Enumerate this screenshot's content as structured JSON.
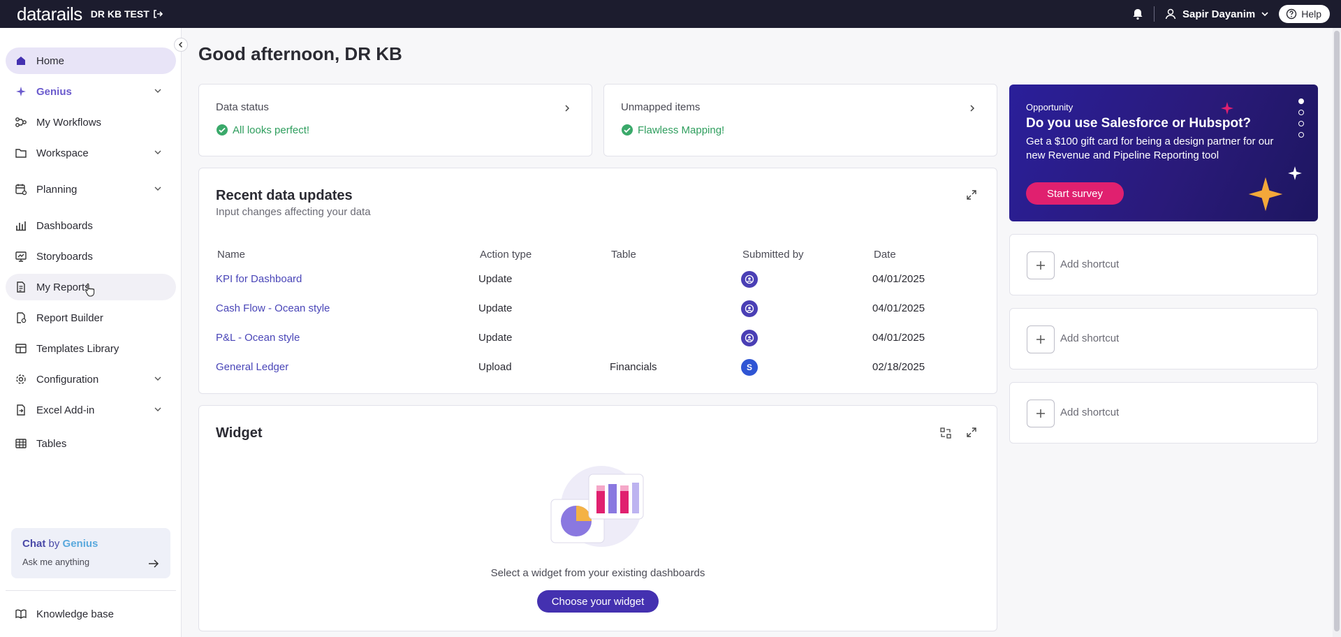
{
  "app": {
    "logo": "datarails",
    "workspace": "DR KB TEST"
  },
  "topbar": {
    "user_name": "Sapir Dayanim",
    "help_label": "Help"
  },
  "sidebar": {
    "items": [
      {
        "label": "Home"
      },
      {
        "label": "Genius"
      },
      {
        "label": "My Workflows"
      },
      {
        "label": "Workspace"
      },
      {
        "label": "Planning"
      },
      {
        "label": "Dashboards"
      },
      {
        "label": "Storyboards"
      },
      {
        "label": "My Reports"
      },
      {
        "label": "Report Builder"
      },
      {
        "label": "Templates Library"
      },
      {
        "label": "Configuration"
      },
      {
        "label": "Excel Add-in"
      },
      {
        "label": "Tables"
      }
    ],
    "chat": {
      "title_prefix": "Chat",
      "title_by": "by",
      "title_brand": "Genius",
      "subtitle": "Ask me anything"
    },
    "knowledge_base": "Knowledge base"
  },
  "main": {
    "greeting": "Good afternoon, DR KB",
    "data_status": {
      "label": "Data status",
      "status": "All looks perfect!"
    },
    "unmapped": {
      "label": "Unmapped items",
      "status": "Flawless Mapping!"
    },
    "recent": {
      "title": "Recent data updates",
      "subtitle": "Input changes affecting your data",
      "columns": [
        "Name",
        "Action type",
        "Table",
        "Submitted by",
        "Date"
      ],
      "rows": [
        {
          "name": "KPI for Dashboard",
          "action": "Update",
          "table": "",
          "submitted": "",
          "date": "04/01/2025"
        },
        {
          "name": "Cash Flow - Ocean style",
          "action": "Update",
          "table": "",
          "submitted": "",
          "date": "04/01/2025"
        },
        {
          "name": "P&L - Ocean style",
          "action": "Update",
          "table": "",
          "submitted": "",
          "date": "04/01/2025"
        },
        {
          "name": "General Ledger",
          "action": "Upload",
          "table": "Financials",
          "submitted": "S",
          "date": "02/18/2025"
        }
      ]
    },
    "widget": {
      "title": "Widget",
      "empty_text": "Select a widget from your existing dashboards",
      "button": "Choose your widget"
    }
  },
  "promo": {
    "eyebrow": "Opportunity",
    "title": "Do you use Salesforce or Hubspot?",
    "body": "Get a $100 gift card for being a design partner for our new Revenue and Pipeline Reporting tool",
    "button": "Start survey",
    "slides": 4,
    "active_slide": 1
  },
  "shortcuts": [
    {
      "label": "Add shortcut"
    },
    {
      "label": "Add shortcut"
    },
    {
      "label": "Add shortcut"
    }
  ],
  "colors": {
    "topbar": "#1c1c2e",
    "accent": "#4431b0",
    "success": "#2f9e5e",
    "link": "#4a46b8",
    "promo_button": "#e0206f"
  }
}
